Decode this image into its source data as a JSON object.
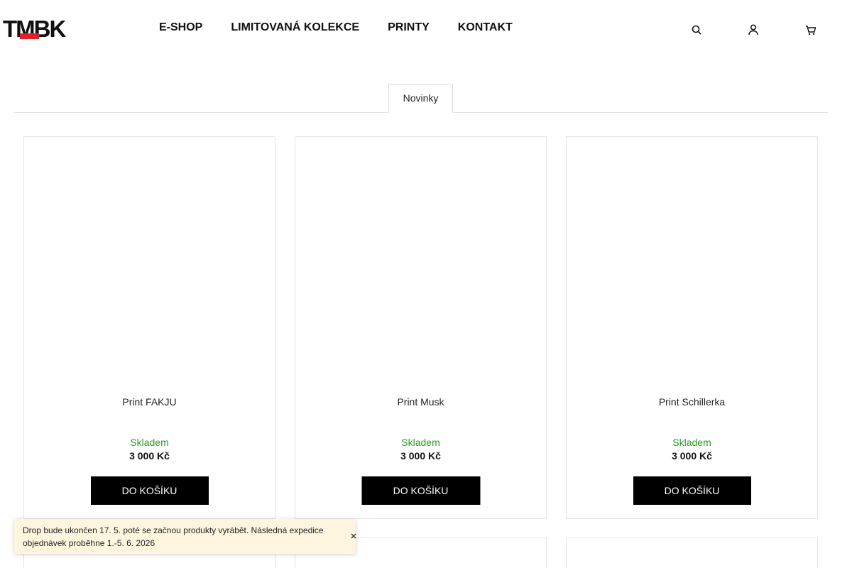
{
  "brand": {
    "logo_text": "TMBK",
    "accent_color": "#e0212b"
  },
  "nav": {
    "items": [
      {
        "label": "E-SHOP"
      },
      {
        "label": "LIMITOVANÁ KOLEKCE"
      },
      {
        "label": "PRINTY"
      },
      {
        "label": "KONTAKT"
      }
    ]
  },
  "header_icons": [
    "search-icon",
    "user-icon",
    "cart-icon"
  ],
  "tabs": [
    {
      "label": "Novinky",
      "active": true
    }
  ],
  "products": [
    {
      "name": "Print FAKJU",
      "stock": "Skladem",
      "price": "3 000 Kč",
      "button": "DO KOŠÍKU"
    },
    {
      "name": "Print Musk",
      "stock": "Skladem",
      "price": "3 000 Kč",
      "button": "DO KOŠÍKU"
    },
    {
      "name": "Print Schillerka",
      "stock": "Skladem",
      "price": "3 000 Kč",
      "button": "DO KOŠÍKU"
    }
  ],
  "notice": {
    "text": "Drop bude ukončen 17. 5. poté se začnou produkty vyrábět. Následná expedice objednávek proběhne 1.-5. 6. 2026",
    "close_icon": "close-icon"
  },
  "colors": {
    "stock": "#2a9d1f",
    "button_bg": "#000000",
    "notice_bg": "#fdf5dd"
  }
}
